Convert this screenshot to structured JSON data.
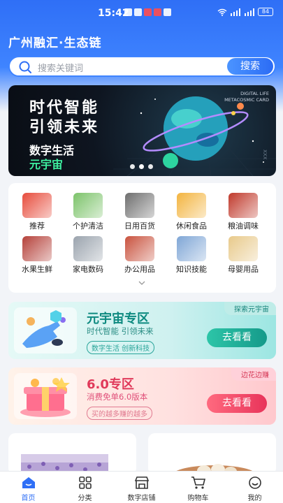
{
  "status_bar": {
    "time": "15:42",
    "battery": "84"
  },
  "app_title": "广州融汇·生态链",
  "search": {
    "placeholder": "搜索关键词",
    "button": "搜索"
  },
  "banner": {
    "line1": "时代智能",
    "line2": "引领未来",
    "line3": "数字生活",
    "line4": "元宇宙",
    "tag_line1": "DIGITAL LIFE",
    "tag_line2": "METACOSMIC CARD",
    "side_text": "XXX",
    "slides": 3,
    "active_slide": 1
  },
  "categories": [
    {
      "label": "推荐",
      "icon": "recommend-badge-icon",
      "color": "#e74c3c"
    },
    {
      "label": "个护清洁",
      "icon": "tissue-pack-icon",
      "color": "#7cc36a"
    },
    {
      "label": "日用百货",
      "icon": "pot-icon",
      "color": "#6e6e6e"
    },
    {
      "label": "休闲食品",
      "icon": "snack-box-icon",
      "color": "#f3b43f"
    },
    {
      "label": "粮油调味",
      "icon": "oil-bottle-icon",
      "color": "#c0392b"
    },
    {
      "label": "水果生鲜",
      "icon": "fresh-food-icon",
      "color": "#b5413a"
    },
    {
      "label": "家电数码",
      "icon": "washing-machine-icon",
      "color": "#9aa3ad"
    },
    {
      "label": "办公用品",
      "icon": "office-supplies-icon",
      "color": "#c9523e"
    },
    {
      "label": "知识技能",
      "icon": "knowledge-icon",
      "color": "#7fa6d6"
    },
    {
      "label": "母婴用品",
      "icon": "milk-powder-icon",
      "color": "#e8c98a"
    }
  ],
  "promos": [
    {
      "corner": "探索元宇宙",
      "title": "元宇宙专区",
      "subtitle": "时代智能 引领未来",
      "pill": "数字生活 创新科技",
      "button": "去看看"
    },
    {
      "corner": "边花边赚",
      "title": "6.0专区",
      "subtitle": "消费免单6.0版本",
      "pill": "买的越多赚的越多",
      "button": "去看看"
    }
  ],
  "nav": [
    {
      "label": "首页",
      "icon": "home-icon",
      "active": true
    },
    {
      "label": "分类",
      "icon": "grid-icon",
      "active": false
    },
    {
      "label": "数字店铺",
      "icon": "store-icon",
      "active": false
    },
    {
      "label": "购物车",
      "icon": "cart-icon",
      "active": false
    },
    {
      "label": "我的",
      "icon": "profile-icon",
      "active": false
    }
  ],
  "colors": {
    "primary": "#2f6ff6",
    "teal": "#159a8a",
    "pink": "#e8345a"
  }
}
